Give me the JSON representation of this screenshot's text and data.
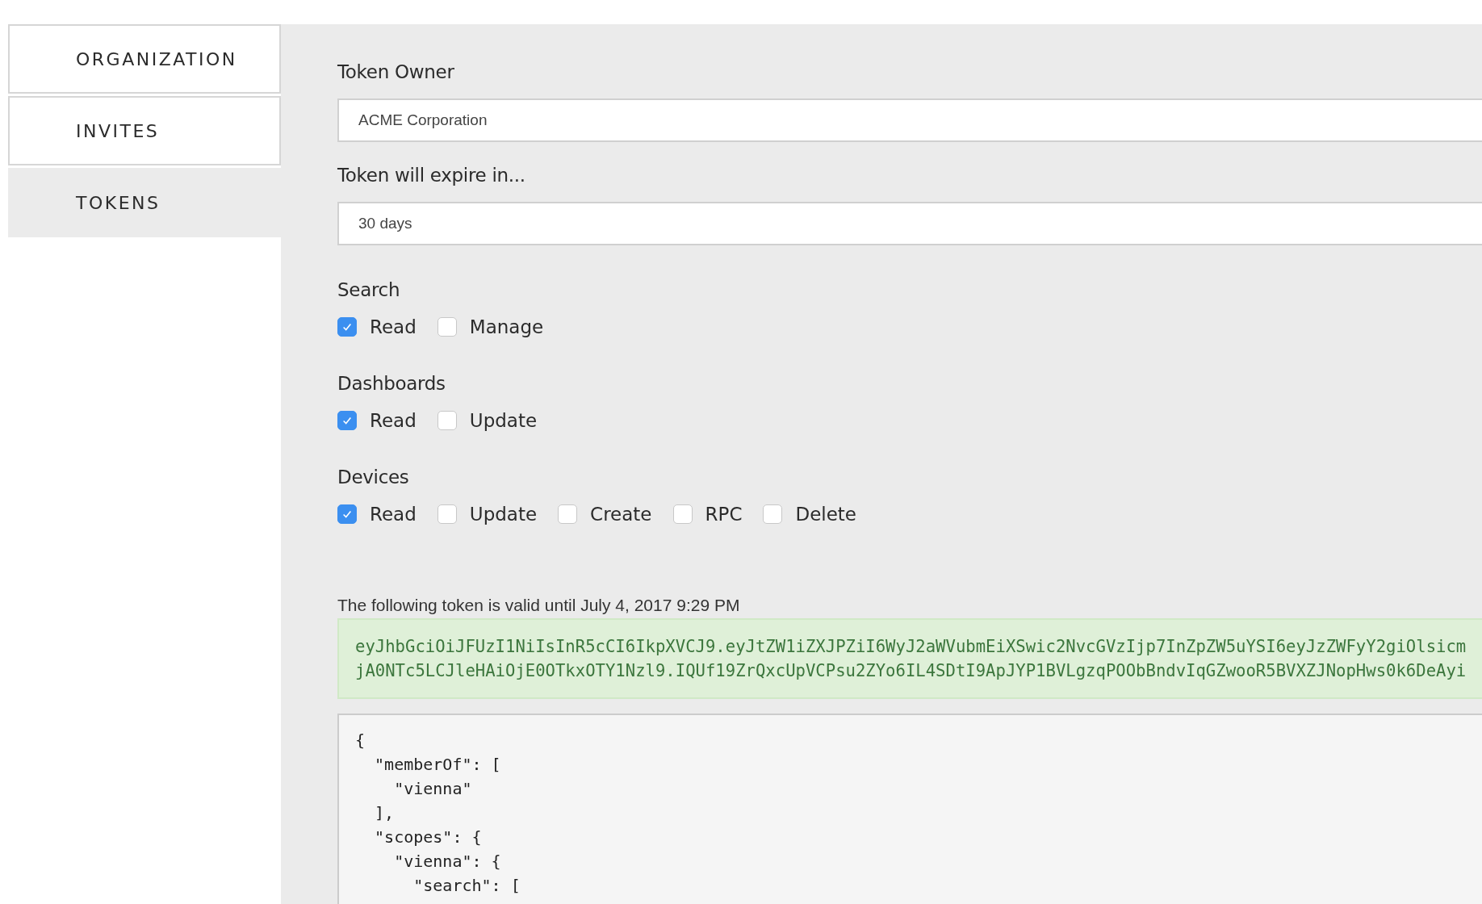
{
  "sidebar": {
    "items": [
      {
        "label": "ORGANIZATION",
        "selected": false
      },
      {
        "label": "INVITES",
        "selected": false
      },
      {
        "label": "TOKENS",
        "selected": true
      }
    ]
  },
  "form": {
    "fields": [
      {
        "label": "Token Owner",
        "value": "ACME Corporation"
      },
      {
        "label": "Token will expire in...",
        "value": "30 days"
      }
    ],
    "scopes": [
      {
        "label": "Search",
        "options": [
          {
            "label": "Read",
            "checked": true
          },
          {
            "label": "Manage",
            "checked": false
          }
        ]
      },
      {
        "label": "Dashboards",
        "options": [
          {
            "label": "Read",
            "checked": true
          },
          {
            "label": "Update",
            "checked": false
          }
        ]
      },
      {
        "label": "Devices",
        "options": [
          {
            "label": "Read",
            "checked": true
          },
          {
            "label": "Update",
            "checked": false
          },
          {
            "label": "Create",
            "checked": false
          },
          {
            "label": "RPC",
            "checked": false
          },
          {
            "label": "Delete",
            "checked": false
          }
        ]
      }
    ]
  },
  "token": {
    "validity": "The following token is valid until July 4, 2017 9:29 PM",
    "lines": [
      "eyJhbGciOiJFUzI1NiIsInR5cCI6IkpXVCJ9.eyJtZW1iZXJPZiI6WyJ2aWVubmEiXSwic2NvcGVzIjp7InZpZW5uYSI6eyJzZWFyY2giOlsicm",
      "jA0NTc5LCJleHAiOjE0OTkxOTY1Nzl9.IQUf19ZrQxcUpVCPsu2ZYo6IL4SDtI9ApJYP1BVLgzqPOObBndvIqGZwooR5BVXZJNopHws0k6DeAyi"
    ],
    "payload_lines": [
      "{",
      "  \"memberOf\": [",
      "    \"vienna\"",
      "  ],",
      "  \"scopes\": {",
      "    \"vienna\": {",
      "      \"search\": ["
    ]
  }
}
